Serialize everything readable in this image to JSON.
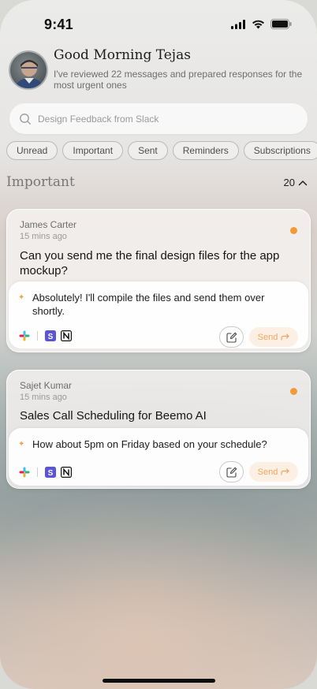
{
  "status_bar": {
    "time": "9:41"
  },
  "header": {
    "greeting": "Good Morning Tejas",
    "subtitle": "I've reviewed 22 messages and prepared responses for the most urgent ones"
  },
  "search": {
    "placeholder": "Design Feedback from Slack"
  },
  "filters": [
    "Unread",
    "Important",
    "Sent",
    "Reminders",
    "Subscriptions"
  ],
  "section": {
    "title": "Important",
    "count": "20"
  },
  "messages": [
    {
      "sender": "James Carter",
      "time": "15 mins ago",
      "subject": "Can you send me the final design files for the app mockup?",
      "reply": "Absolutely! I'll compile the files and send them over shortly.",
      "send_label": "Send",
      "unread": true
    },
    {
      "sender": "Sajet Kumar",
      "time": "15 mins ago",
      "subject": "Sales Call Scheduling for Beemo AI",
      "reply": "How about 5pm on Friday based on your schedule?",
      "send_label": "Send",
      "unread": true
    }
  ],
  "colors": {
    "accent": "#f39a35",
    "send_text": "#f1a560",
    "send_bg": "#fcf0e4"
  },
  "icons": [
    "signal-icon",
    "wifi-icon",
    "battery-icon",
    "search-icon",
    "chevron-up-icon",
    "sparkle-icon",
    "slack-icon",
    "s-app-icon",
    "notion-icon",
    "edit-icon",
    "send-arrow-icon"
  ]
}
